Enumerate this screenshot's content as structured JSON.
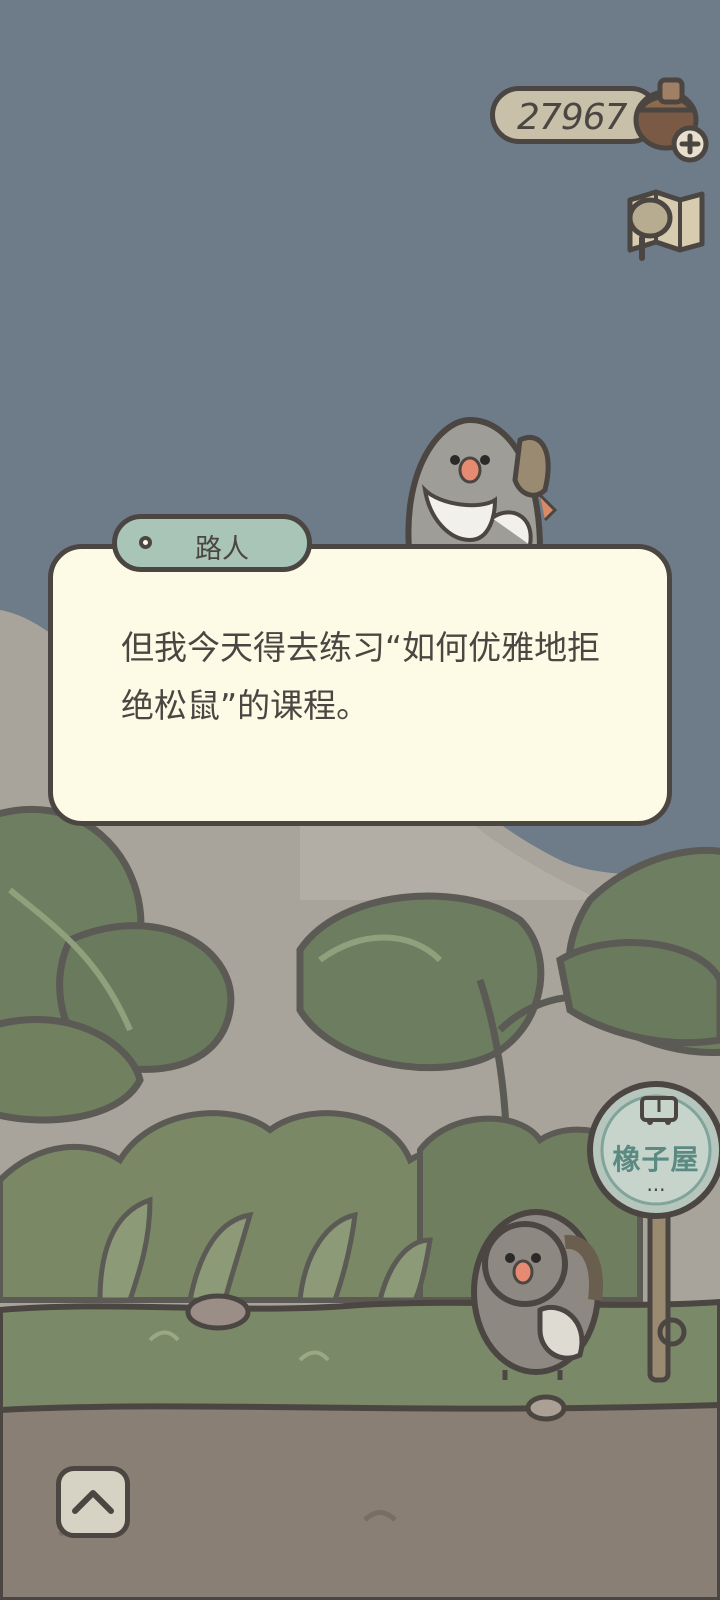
{
  "hud": {
    "acorn_count": "27967",
    "acorn_icon": "acorn-plus-icon",
    "map_icon": "map-icon"
  },
  "dialog": {
    "speaker": "路人",
    "text": "但我今天得去练习“如何优雅地拒绝松鼠”的课程。"
  },
  "bus_stop": {
    "name": "橡子屋",
    "icon": "bus-icon",
    "dots": "···"
  },
  "controls": {
    "expand_icon": "chevron-up-icon"
  },
  "colors": {
    "sky": "#6e7b88",
    "mountain": "#a9a49b",
    "foliage": "#6c7c5e",
    "ground": "#8a7f74",
    "grass": "#7a8a68",
    "outline": "#4b4642",
    "dialog_bg": "#fdfbe6",
    "speaker_tag": "#a8c5b8"
  }
}
